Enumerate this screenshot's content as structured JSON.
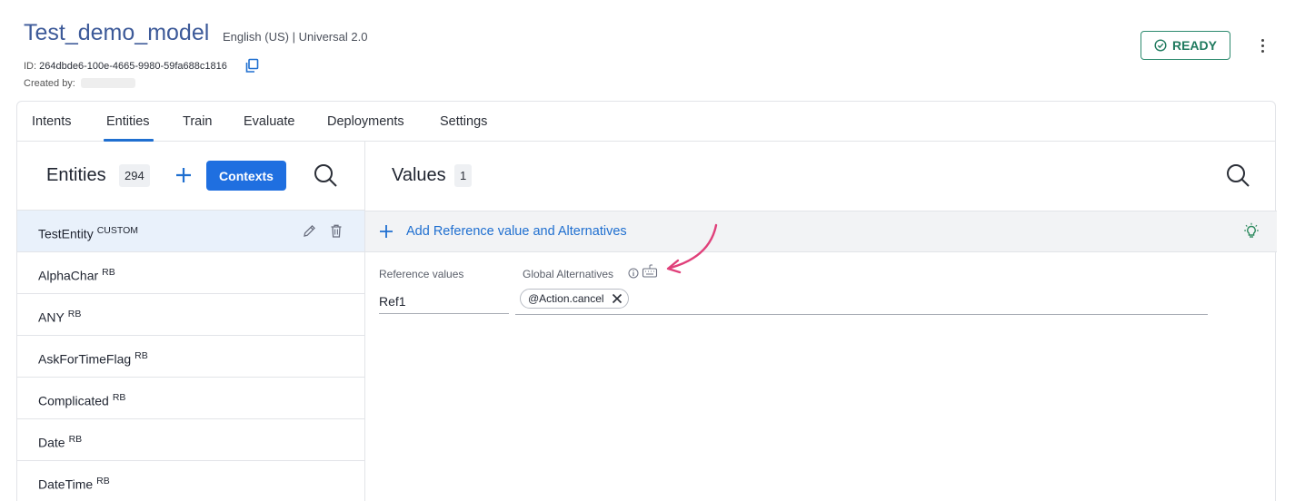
{
  "header": {
    "model_name": "Test_demo_model",
    "language_info": "English (US) | Universal 2.0",
    "id_label": "ID:",
    "id_value": "264dbde6-100e-4665-9980-59fa688c1816",
    "created_by_label": "Created by:",
    "status_button": "READY"
  },
  "tabs": [
    "Intents",
    "Entities",
    "Train",
    "Evaluate",
    "Deployments",
    "Settings"
  ],
  "active_tab": "Entities",
  "entities_panel": {
    "title": "Entities",
    "count": "294",
    "contexts_button": "Contexts",
    "items": [
      {
        "name": "TestEntity",
        "tag": "CUSTOM"
      },
      {
        "name": "AlphaChar",
        "tag": "RB"
      },
      {
        "name": "ANY",
        "tag": "RB"
      },
      {
        "name": "AskForTimeFlag",
        "tag": "RB"
      },
      {
        "name": "Complicated",
        "tag": "RB"
      },
      {
        "name": "Date",
        "tag": "RB"
      },
      {
        "name": "DateTime",
        "tag": "RB"
      }
    ]
  },
  "values_panel": {
    "title": "Values",
    "count": "1",
    "add_label": "Add Reference value and Alternatives",
    "reference_label": "Reference values",
    "alternatives_label": "Global Alternatives",
    "reference_value": "Ref1",
    "alternatives": [
      "@Action.cancel"
    ]
  },
  "colors": {
    "accent": "#1f6fe0",
    "title": "#3d5a99",
    "ready": "#1f7a5e",
    "annotation_arrow": "#e0407a"
  }
}
